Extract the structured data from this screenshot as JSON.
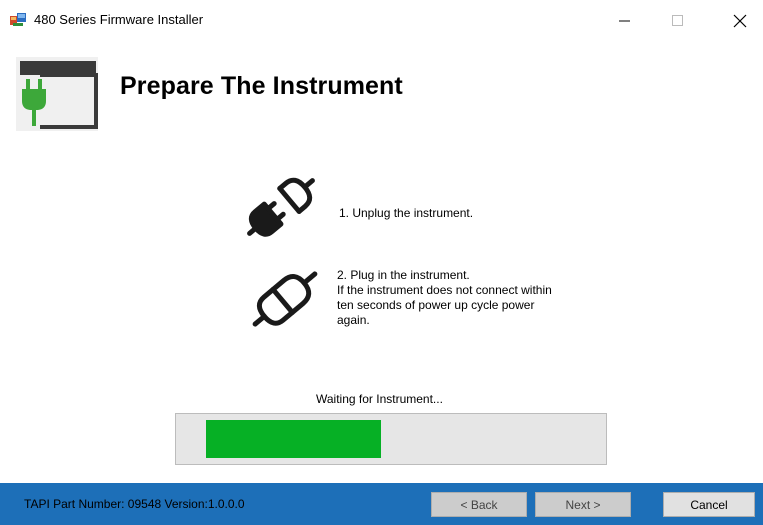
{
  "window": {
    "title": "480 Series Firmware Installer",
    "icons": {
      "app": "installer-icon",
      "minimize": "minimize-icon",
      "maximize": "maximize-icon",
      "close": "close-icon"
    }
  },
  "header": {
    "title": "Prepare The Instrument",
    "icon": "plug-window-icon"
  },
  "steps": [
    {
      "icon": "unplugged-icon",
      "lines": [
        "1. Unplug the instrument."
      ]
    },
    {
      "icon": "plugged-icon",
      "lines": [
        "2. Plug in the instrument.",
        "If the instrument does not connect within",
        "ten seconds of power up cycle power",
        "again."
      ]
    }
  ],
  "progress": {
    "status": "Waiting for Instrument...",
    "value": 0.47,
    "color": "#06b025"
  },
  "footer": {
    "part_info": "TAPI Part Number: 09548  Version:1.0.0.0",
    "back_label": "< Back",
    "next_label": "Next >",
    "cancel_label": "Cancel",
    "color": "#1d6fb8"
  }
}
